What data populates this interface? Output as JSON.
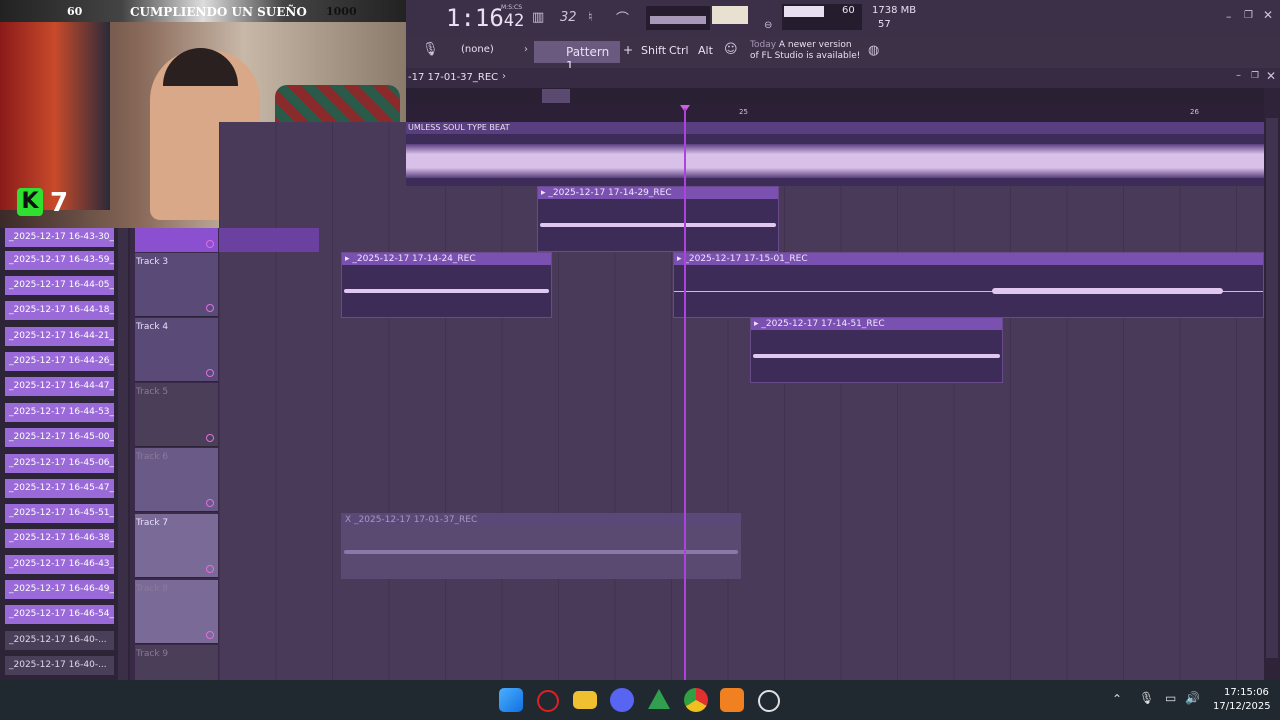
{
  "overlay": {
    "left_value": "60",
    "title": "CUMPLIENDO UN SUEÑO",
    "right_value": "1000",
    "badge_letter": "K",
    "badge_number": "7"
  },
  "topbar": {
    "time_main": "1:16",
    "time_seconds": "42",
    "time_label": "M:S:CS",
    "tempo_icon": "32",
    "cpu_value": "60",
    "memory": "1738 MB",
    "polyphony": "57"
  },
  "toolbar": {
    "input_select": "(none)",
    "pattern": "Pattern 1",
    "add_pattern": "+",
    "key_shift": "Shift",
    "key_ctrl": "Ctrl",
    "key_alt": "Alt",
    "news_prefix": "Today",
    "news_text": "A newer version of FL Studio is available!"
  },
  "window": {
    "title": "-17 17-01-37_REC",
    "arrow": "›"
  },
  "ruler": {
    "marks": [
      "25",
      "26"
    ]
  },
  "tracks": [
    {
      "name": "Track 3",
      "dim": false
    },
    {
      "name": "Track 4",
      "dim": false
    },
    {
      "name": "Track 5",
      "dim": true
    },
    {
      "name": "Track 6",
      "dim": true
    },
    {
      "name": "Track 7",
      "dim": false
    },
    {
      "name": "Track 8",
      "dim": true
    },
    {
      "name": "Track 9",
      "dim": true
    }
  ],
  "clips": {
    "beat": "UMLESS SOUL TYPE BEAT",
    "c1": "▸ _2025-12-17 17-14-29_REC",
    "c2": "▸ _2025-12-17 17-14-24_REC",
    "c3": "▸ _2025-12-17 17-15-01_REC",
    "c4": "▸ _2025-12-17 17-14-51_REC",
    "c5": "X _2025-12-17 17-01-37_REC"
  },
  "sidebar": {
    "items": [
      "_2025-12-17 16-43-30_R..",
      "_2025-12-17 16-43-59_R..",
      "_2025-12-17 16-44-05_R..",
      "_2025-12-17 16-44-18_R..",
      "_2025-12-17 16-44-21_R..",
      "_2025-12-17 16-44-26_R..",
      "_2025-12-17 16-44-47_R..",
      "_2025-12-17 16-44-53_R..",
      "_2025-12-17 16-45-00_R..",
      "_2025-12-17 16-45-06_R..",
      "_2025-12-17 16-45-47_R..",
      "_2025-12-17 16-45-51_R..",
      "_2025-12-17 16-46-38_R..",
      "_2025-12-17 16-46-43_R..",
      "_2025-12-17 16-46-49_R..",
      "_2025-12-17 16-46-54_R..",
      "_2025-12-17 16-40-...",
      "_2025-12-17 16-40-..."
    ]
  },
  "taskbar": {
    "time": "17:15:06",
    "date": "17/12/2025"
  },
  "colors": {
    "accent": "#9a6ad8",
    "playhead": "#b040e0",
    "background": "#3a2a48"
  }
}
